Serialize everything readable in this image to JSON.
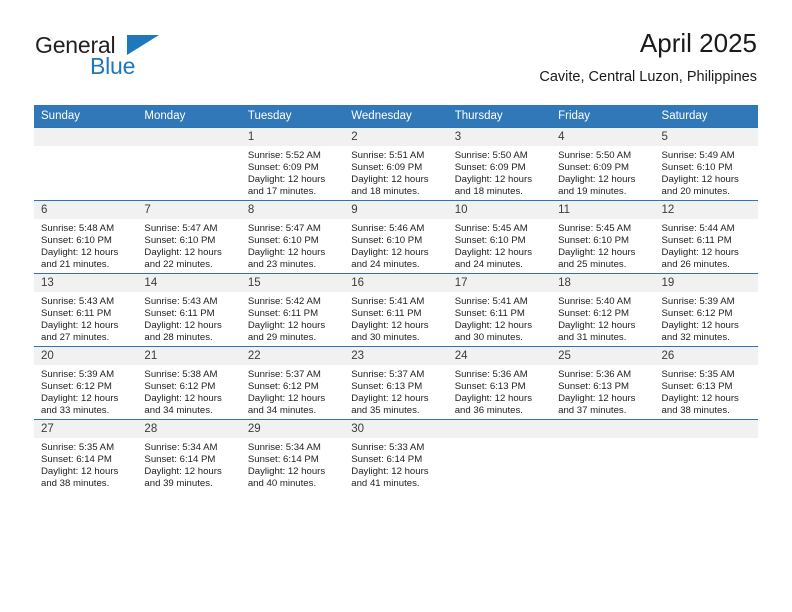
{
  "brand": {
    "name_part1": "General",
    "name_part2": "Blue",
    "triangle_icon": "triangle-icon",
    "accent_color": "#1f77bc"
  },
  "header": {
    "title": "April 2025",
    "subtitle": "Cavite, Central Luzon, Philippines"
  },
  "theme": {
    "header_blue": "#3178b8",
    "row_divider_blue": "#2e74b5",
    "daynum_band": "#f1f1f1"
  },
  "weekday_headers": [
    "Sunday",
    "Monday",
    "Tuesday",
    "Wednesday",
    "Thursday",
    "Friday",
    "Saturday"
  ],
  "weeks": [
    [
      {
        "day": "",
        "sunrise": "",
        "sunset": "",
        "daylight1": "",
        "daylight2": ""
      },
      {
        "day": "",
        "sunrise": "",
        "sunset": "",
        "daylight1": "",
        "daylight2": ""
      },
      {
        "day": "1",
        "sunrise": "Sunrise: 5:52 AM",
        "sunset": "Sunset: 6:09 PM",
        "daylight1": "Daylight: 12 hours",
        "daylight2": "and 17 minutes."
      },
      {
        "day": "2",
        "sunrise": "Sunrise: 5:51 AM",
        "sunset": "Sunset: 6:09 PM",
        "daylight1": "Daylight: 12 hours",
        "daylight2": "and 18 minutes."
      },
      {
        "day": "3",
        "sunrise": "Sunrise: 5:50 AM",
        "sunset": "Sunset: 6:09 PM",
        "daylight1": "Daylight: 12 hours",
        "daylight2": "and 18 minutes."
      },
      {
        "day": "4",
        "sunrise": "Sunrise: 5:50 AM",
        "sunset": "Sunset: 6:09 PM",
        "daylight1": "Daylight: 12 hours",
        "daylight2": "and 19 minutes."
      },
      {
        "day": "5",
        "sunrise": "Sunrise: 5:49 AM",
        "sunset": "Sunset: 6:10 PM",
        "daylight1": "Daylight: 12 hours",
        "daylight2": "and 20 minutes."
      }
    ],
    [
      {
        "day": "6",
        "sunrise": "Sunrise: 5:48 AM",
        "sunset": "Sunset: 6:10 PM",
        "daylight1": "Daylight: 12 hours",
        "daylight2": "and 21 minutes."
      },
      {
        "day": "7",
        "sunrise": "Sunrise: 5:47 AM",
        "sunset": "Sunset: 6:10 PM",
        "daylight1": "Daylight: 12 hours",
        "daylight2": "and 22 minutes."
      },
      {
        "day": "8",
        "sunrise": "Sunrise: 5:47 AM",
        "sunset": "Sunset: 6:10 PM",
        "daylight1": "Daylight: 12 hours",
        "daylight2": "and 23 minutes."
      },
      {
        "day": "9",
        "sunrise": "Sunrise: 5:46 AM",
        "sunset": "Sunset: 6:10 PM",
        "daylight1": "Daylight: 12 hours",
        "daylight2": "and 24 minutes."
      },
      {
        "day": "10",
        "sunrise": "Sunrise: 5:45 AM",
        "sunset": "Sunset: 6:10 PM",
        "daylight1": "Daylight: 12 hours",
        "daylight2": "and 24 minutes."
      },
      {
        "day": "11",
        "sunrise": "Sunrise: 5:45 AM",
        "sunset": "Sunset: 6:10 PM",
        "daylight1": "Daylight: 12 hours",
        "daylight2": "and 25 minutes."
      },
      {
        "day": "12",
        "sunrise": "Sunrise: 5:44 AM",
        "sunset": "Sunset: 6:11 PM",
        "daylight1": "Daylight: 12 hours",
        "daylight2": "and 26 minutes."
      }
    ],
    [
      {
        "day": "13",
        "sunrise": "Sunrise: 5:43 AM",
        "sunset": "Sunset: 6:11 PM",
        "daylight1": "Daylight: 12 hours",
        "daylight2": "and 27 minutes."
      },
      {
        "day": "14",
        "sunrise": "Sunrise: 5:43 AM",
        "sunset": "Sunset: 6:11 PM",
        "daylight1": "Daylight: 12 hours",
        "daylight2": "and 28 minutes."
      },
      {
        "day": "15",
        "sunrise": "Sunrise: 5:42 AM",
        "sunset": "Sunset: 6:11 PM",
        "daylight1": "Daylight: 12 hours",
        "daylight2": "and 29 minutes."
      },
      {
        "day": "16",
        "sunrise": "Sunrise: 5:41 AM",
        "sunset": "Sunset: 6:11 PM",
        "daylight1": "Daylight: 12 hours",
        "daylight2": "and 30 minutes."
      },
      {
        "day": "17",
        "sunrise": "Sunrise: 5:41 AM",
        "sunset": "Sunset: 6:11 PM",
        "daylight1": "Daylight: 12 hours",
        "daylight2": "and 30 minutes."
      },
      {
        "day": "18",
        "sunrise": "Sunrise: 5:40 AM",
        "sunset": "Sunset: 6:12 PM",
        "daylight1": "Daylight: 12 hours",
        "daylight2": "and 31 minutes."
      },
      {
        "day": "19",
        "sunrise": "Sunrise: 5:39 AM",
        "sunset": "Sunset: 6:12 PM",
        "daylight1": "Daylight: 12 hours",
        "daylight2": "and 32 minutes."
      }
    ],
    [
      {
        "day": "20",
        "sunrise": "Sunrise: 5:39 AM",
        "sunset": "Sunset: 6:12 PM",
        "daylight1": "Daylight: 12 hours",
        "daylight2": "and 33 minutes."
      },
      {
        "day": "21",
        "sunrise": "Sunrise: 5:38 AM",
        "sunset": "Sunset: 6:12 PM",
        "daylight1": "Daylight: 12 hours",
        "daylight2": "and 34 minutes."
      },
      {
        "day": "22",
        "sunrise": "Sunrise: 5:37 AM",
        "sunset": "Sunset: 6:12 PM",
        "daylight1": "Daylight: 12 hours",
        "daylight2": "and 34 minutes."
      },
      {
        "day": "23",
        "sunrise": "Sunrise: 5:37 AM",
        "sunset": "Sunset: 6:13 PM",
        "daylight1": "Daylight: 12 hours",
        "daylight2": "and 35 minutes."
      },
      {
        "day": "24",
        "sunrise": "Sunrise: 5:36 AM",
        "sunset": "Sunset: 6:13 PM",
        "daylight1": "Daylight: 12 hours",
        "daylight2": "and 36 minutes."
      },
      {
        "day": "25",
        "sunrise": "Sunrise: 5:36 AM",
        "sunset": "Sunset: 6:13 PM",
        "daylight1": "Daylight: 12 hours",
        "daylight2": "and 37 minutes."
      },
      {
        "day": "26",
        "sunrise": "Sunrise: 5:35 AM",
        "sunset": "Sunset: 6:13 PM",
        "daylight1": "Daylight: 12 hours",
        "daylight2": "and 38 minutes."
      }
    ],
    [
      {
        "day": "27",
        "sunrise": "Sunrise: 5:35 AM",
        "sunset": "Sunset: 6:14 PM",
        "daylight1": "Daylight: 12 hours",
        "daylight2": "and 38 minutes."
      },
      {
        "day": "28",
        "sunrise": "Sunrise: 5:34 AM",
        "sunset": "Sunset: 6:14 PM",
        "daylight1": "Daylight: 12 hours",
        "daylight2": "and 39 minutes."
      },
      {
        "day": "29",
        "sunrise": "Sunrise: 5:34 AM",
        "sunset": "Sunset: 6:14 PM",
        "daylight1": "Daylight: 12 hours",
        "daylight2": "and 40 minutes."
      },
      {
        "day": "30",
        "sunrise": "Sunrise: 5:33 AM",
        "sunset": "Sunset: 6:14 PM",
        "daylight1": "Daylight: 12 hours",
        "daylight2": "and 41 minutes."
      },
      {
        "day": "",
        "sunrise": "",
        "sunset": "",
        "daylight1": "",
        "daylight2": ""
      },
      {
        "day": "",
        "sunrise": "",
        "sunset": "",
        "daylight1": "",
        "daylight2": ""
      },
      {
        "day": "",
        "sunrise": "",
        "sunset": "",
        "daylight1": "",
        "daylight2": ""
      }
    ]
  ]
}
